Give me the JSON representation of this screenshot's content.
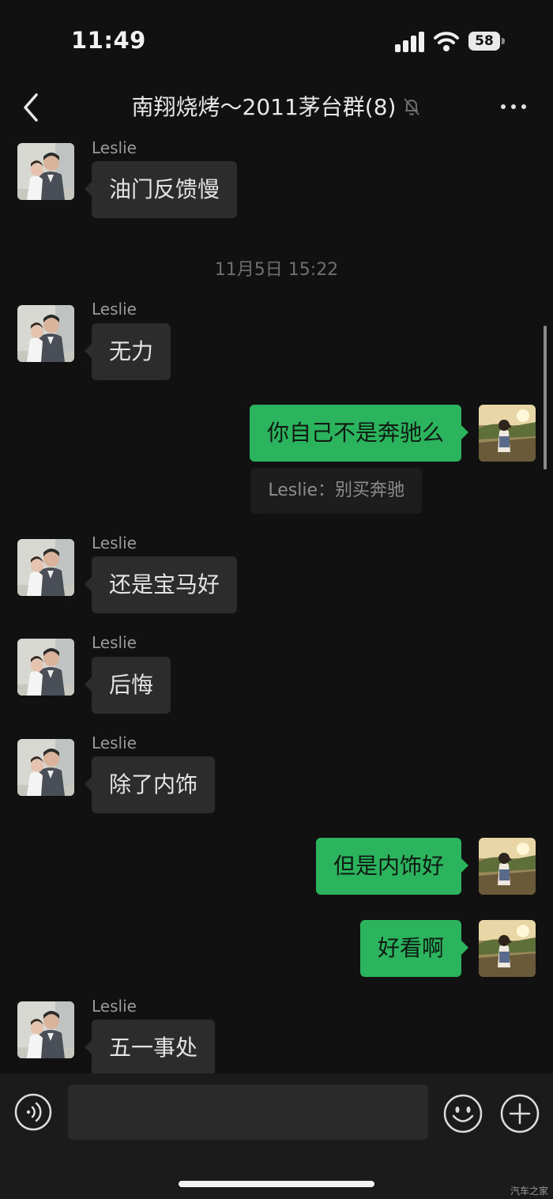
{
  "status_bar": {
    "time": "11:49",
    "battery": "58"
  },
  "nav": {
    "title": "南翔烧烤～2011茅台群(8)"
  },
  "messages": [
    {
      "sender": "Leslie",
      "text": "油门反馈慢"
    },
    {
      "timestamp": "11月5日 15:22"
    },
    {
      "sender": "Leslie",
      "text": "无力"
    },
    {
      "text": "你自己不是奔驰么",
      "quote": "Leslie：别买奔驰"
    },
    {
      "sender": "Leslie",
      "text": "还是宝马好"
    },
    {
      "sender": "Leslie",
      "text": "后悔"
    },
    {
      "sender": "Leslie",
      "text": "除了内饰"
    },
    {
      "text": "但是内饰好"
    },
    {
      "text": "好看啊"
    },
    {
      "sender": "Leslie",
      "text": "五一事处"
    }
  ],
  "input": {
    "placeholder": ""
  },
  "watermark": "汽车之家"
}
